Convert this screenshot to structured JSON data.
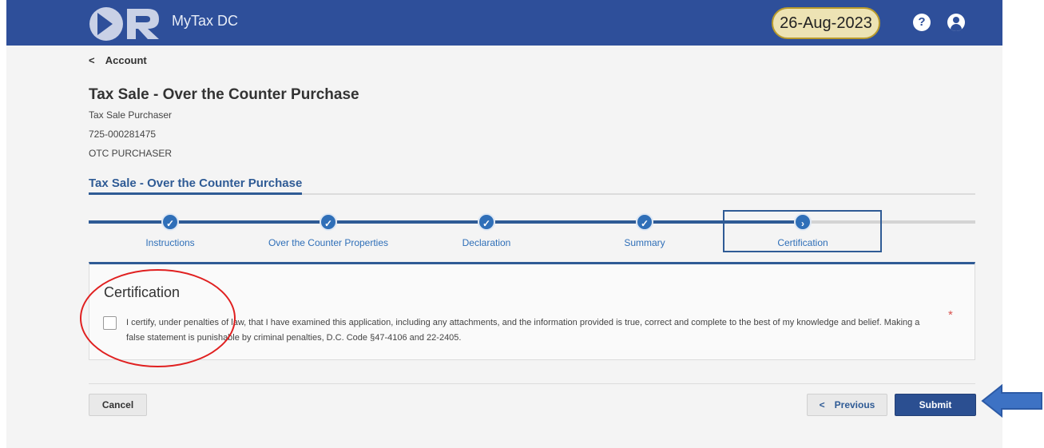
{
  "header": {
    "logo_text": "OTR",
    "app_title": "MyTax DC",
    "date": "26-Aug-2023",
    "help_icon": "?",
    "user_icon": "user-circle-icon"
  },
  "breadcrumb": {
    "chevron": "<",
    "label": "Account"
  },
  "page": {
    "title": "Tax Sale - Over the Counter Purchase",
    "meta": [
      "Tax Sale Purchaser",
      "725-000281475",
      "OTC PURCHASER"
    ],
    "section_tab": "Tax Sale - Over the Counter Purchase"
  },
  "stepper": {
    "steps": [
      {
        "label": "Instructions",
        "icon": "✓"
      },
      {
        "label": "Over the Counter Properties",
        "icon": "✓"
      },
      {
        "label": "Declaration",
        "icon": "✓"
      },
      {
        "label": "Summary",
        "icon": "✓"
      },
      {
        "label": "Certification",
        "icon": "›"
      }
    ],
    "active_index": 4
  },
  "certification": {
    "title": "Certification",
    "text": "I certify, under penalties of law, that I have examined this application, including any attachments, and the information provided is true, correct and complete to the best of my knowledge and belief. Making a false statement is punishable by criminal penalties, D.C. Code §47-4106 and 22-2405.",
    "required_marker": "*",
    "checked": false
  },
  "footer": {
    "cancel_label": "Cancel",
    "previous_label": "Previous",
    "previous_icon": "<",
    "submit_label": "Submit"
  },
  "colors": {
    "header_bg": "#2e4f9a",
    "accent": "#2f5b95",
    "step_dot": "#2f6fb8",
    "annotation_red": "#e02020",
    "annotation_arrow": "#3d72c4"
  }
}
